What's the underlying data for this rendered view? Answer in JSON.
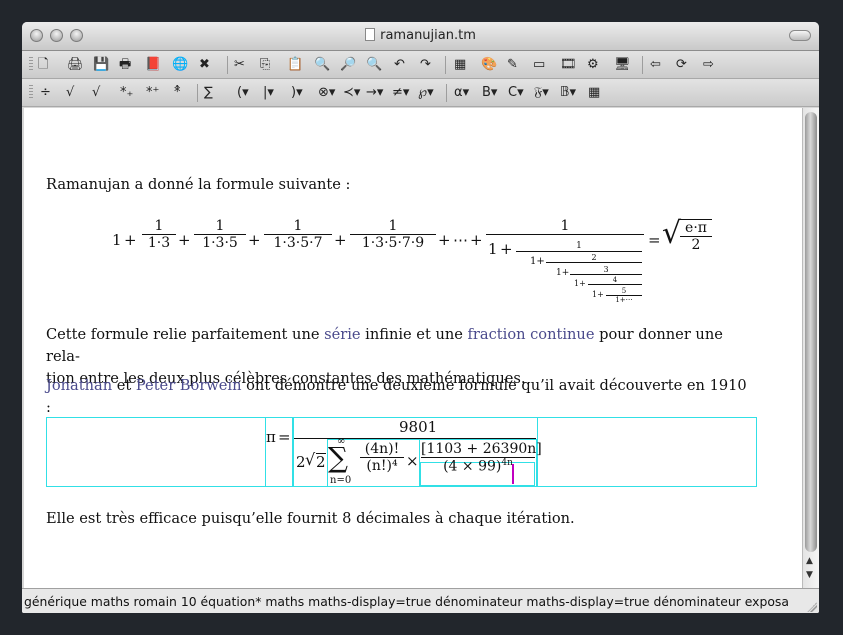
{
  "window": {
    "title": "ramanujian.tm"
  },
  "toolbar1": {
    "buttons": [
      {
        "name": "new-document-icon",
        "glyph": "🗋"
      },
      {
        "name": "open-icon",
        "glyph": "🖨"
      },
      {
        "name": "save-icon",
        "glyph": "💾"
      },
      {
        "name": "print-icon",
        "glyph": "🖶"
      },
      {
        "name": "style-book-icon",
        "glyph": "📕"
      },
      {
        "name": "globe-icon",
        "glyph": "🌐"
      },
      {
        "name": "close-doc-icon",
        "glyph": "✖"
      },
      {
        "name": "cut-icon",
        "glyph": "✂"
      },
      {
        "name": "copy-icon",
        "glyph": "⎘"
      },
      {
        "name": "paste-icon",
        "glyph": "📋"
      },
      {
        "name": "find-icon",
        "glyph": "🔍"
      },
      {
        "name": "replace-icon",
        "glyph": "🔎"
      },
      {
        "name": "spell-check-icon",
        "glyph": "🔍"
      },
      {
        "name": "undo-icon",
        "glyph": "↶"
      },
      {
        "name": "redo-icon",
        "glyph": "↷"
      },
      {
        "name": "table-icon",
        "glyph": "▦"
      },
      {
        "name": "image-icon",
        "glyph": "🎨"
      },
      {
        "name": "pen-icon",
        "glyph": "✎"
      },
      {
        "name": "frame-icon",
        "glyph": "▭"
      },
      {
        "name": "film-icon",
        "glyph": "🎞"
      },
      {
        "name": "tools-icon",
        "glyph": "⚙"
      },
      {
        "name": "monitor-icon",
        "glyph": "🖥"
      },
      {
        "name": "back-icon",
        "glyph": "⇦"
      },
      {
        "name": "refresh-icon",
        "glyph": "⟳"
      },
      {
        "name": "forward-icon",
        "glyph": "⇨"
      }
    ]
  },
  "toolbar2": {
    "buttons": [
      {
        "name": "fraction-button",
        "glyph": "÷"
      },
      {
        "name": "sqrt-button",
        "glyph": "√"
      },
      {
        "name": "nth-root-button",
        "glyph": "√"
      },
      {
        "name": "subscript-button",
        "glyph": "*₊"
      },
      {
        "name": "superscript-button",
        "glyph": "*⁺"
      },
      {
        "name": "accent-button",
        "glyph": "*̂"
      },
      {
        "name": "big-operator-button",
        "glyph": "∑"
      },
      {
        "name": "left-bracket-button",
        "glyph": "(▾"
      },
      {
        "name": "middle-bracket-button",
        "glyph": "|▾"
      },
      {
        "name": "right-bracket-button",
        "glyph": ")▾"
      },
      {
        "name": "binary-operator-button",
        "glyph": "⊗▾"
      },
      {
        "name": "relation-button",
        "glyph": "≺▾"
      },
      {
        "name": "arrow-button",
        "glyph": "→▾"
      },
      {
        "name": "negation-button",
        "glyph": "≠▾"
      },
      {
        "name": "misc-symbol-button",
        "glyph": "℘▾"
      },
      {
        "name": "greek-button",
        "glyph": "α▾"
      },
      {
        "name": "bold-math-button",
        "glyph": "B▾"
      },
      {
        "name": "calligraphic-button",
        "glyph": "C▾"
      },
      {
        "name": "fraktur-button",
        "glyph": "𝔉▾"
      },
      {
        "name": "blackboard-button",
        "glyph": "𝔹▾"
      },
      {
        "name": "color-button",
        "glyph": "▦"
      }
    ]
  },
  "document": {
    "intro": "Ramanujan a donné la formule suivante :",
    "formula1": {
      "one": "1",
      "terms": [
        "1·3",
        "1·3·5",
        "1·3·5·7",
        "1·3·5·7·9"
      ],
      "ellipsis": "⋯",
      "cf_levels": [
        "1",
        "2",
        "3",
        "4",
        "5",
        "1+⋯"
      ],
      "rhs_num": "e·π",
      "rhs_den": "2"
    },
    "para2": {
      "before": "Cette formule relie parfaitement une ",
      "link1": "série",
      "mid": " infinie et une ",
      "link2": "fraction continue",
      "after": " pour donner une rela-",
      "line2": "tion entre les deux plus célèbres constantes des mathématiques."
    },
    "para3": {
      "link1": "Jonathan",
      "mid": " et ",
      "link2": "Peter Borwein",
      "after": " ont démontré une deuxième formule qu’il avait découverte en 1910 :"
    },
    "formula2": {
      "pi": "π",
      "eq": "=",
      "numerator": "9801",
      "two": "2",
      "sqrt2": "2",
      "sum_top": "∞",
      "sum_sym": "∑",
      "sum_bottom": "n=0",
      "frac_num": "(4n)!",
      "frac_den": "(n!)⁴",
      "times": "×",
      "bracket_num": "[1103 + 26390n]",
      "bracket_den": "(4 × 99)",
      "exponent": "4n"
    },
    "closing": "Elle est très efficace puisqu’elle fournit 8 décimales à chaque itération."
  },
  "status": "générique maths romain 10  équation* maths maths-display=true dénominateur maths-display=true dénominateur exposa"
}
